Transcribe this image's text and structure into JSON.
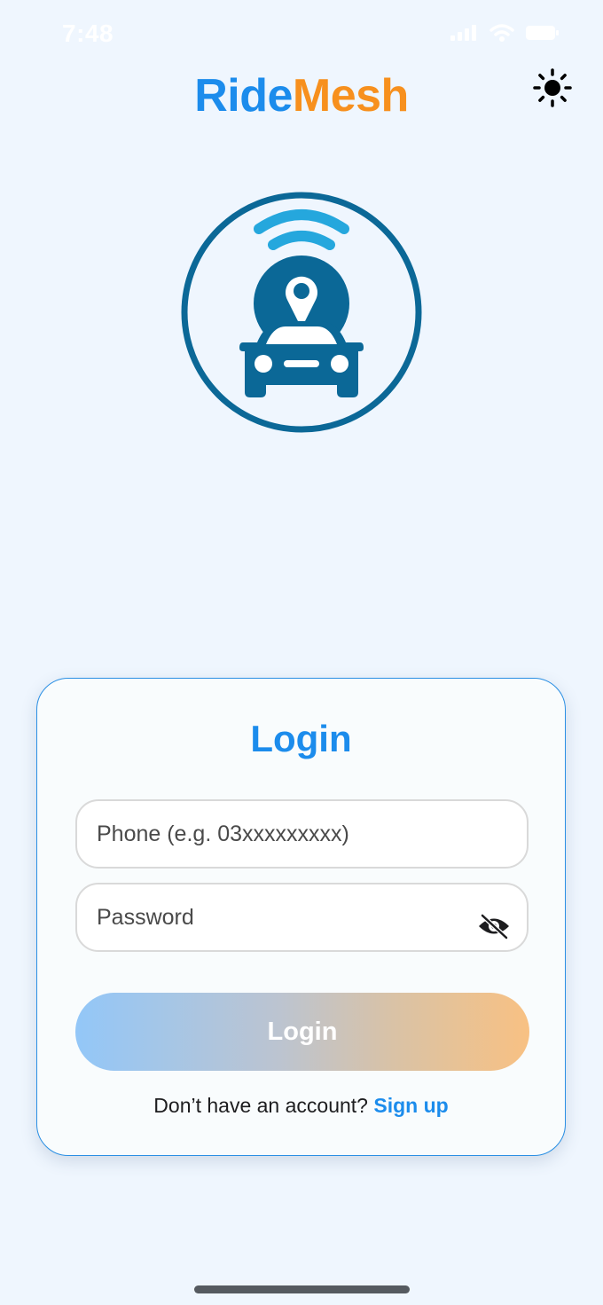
{
  "status_bar": {
    "time": "7:48",
    "icons": [
      "signal-icon",
      "wifi-icon",
      "battery-icon"
    ]
  },
  "header": {
    "brand_part_a": "Ride",
    "brand_part_b": "Mesh",
    "theme_toggle_icon": "sun-icon"
  },
  "logo": {
    "icon": "car-location-wifi-icon",
    "color": "#0b6897",
    "wifi_color": "#25a7dd"
  },
  "login_card": {
    "title": "Login",
    "phone_placeholder": "Phone (e.g. 03xxxxxxxxx)",
    "phone_value": "",
    "password_placeholder": "Password",
    "password_value": "",
    "password_visibility_icon": "eye-off-icon",
    "login_button_label": "Login",
    "signup_prompt": "Don’t have an account? ",
    "signup_link": "Sign up"
  },
  "colors": {
    "brand_blue": "#1c8cec",
    "brand_orange": "#f7901e",
    "background": "#eff6fe"
  }
}
